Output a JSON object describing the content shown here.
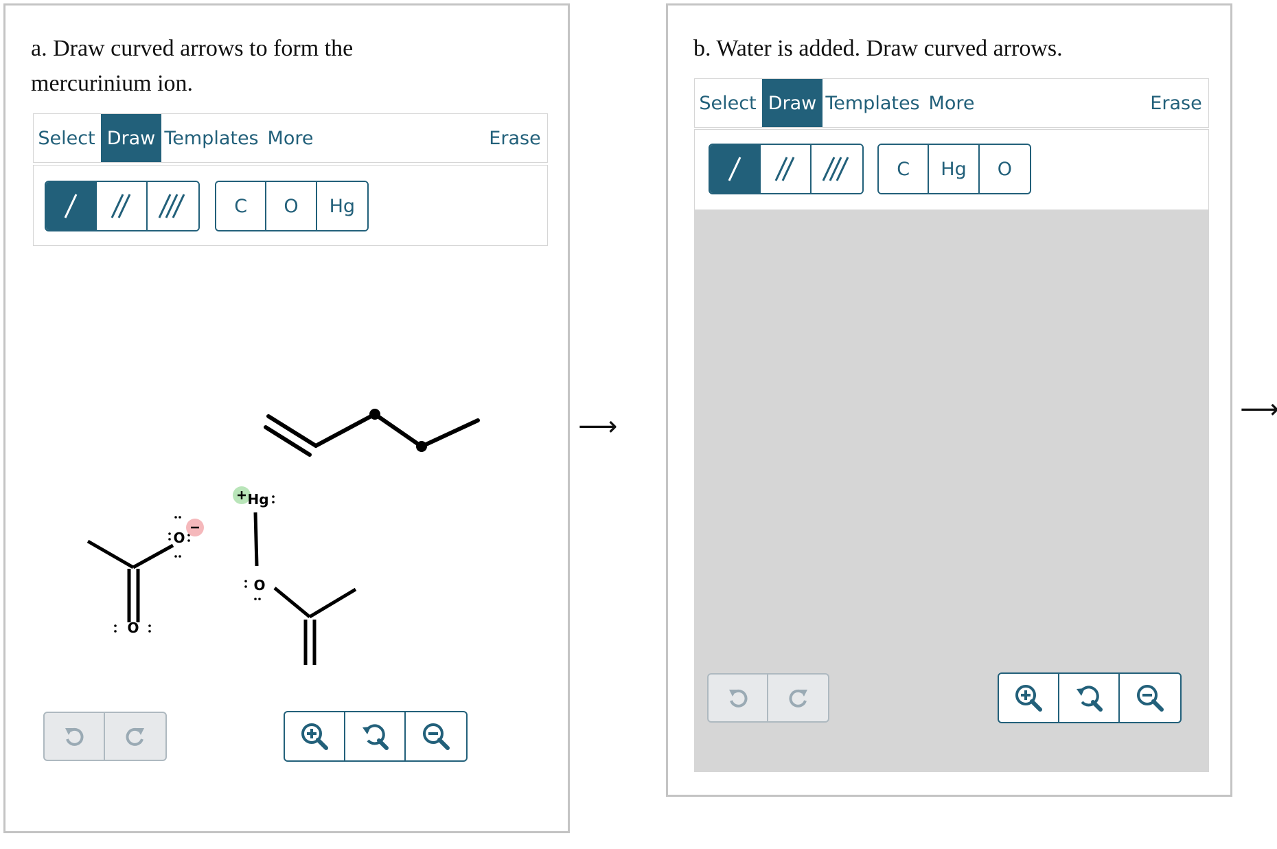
{
  "panel_a": {
    "question": "a. Draw curved arrows to form the mercurinium ion.",
    "tabs": {
      "select": "Select",
      "draw": "Draw",
      "templates": "Templates",
      "more": "More",
      "erase": "Erase"
    },
    "atom_buttons": [
      "C",
      "O",
      "Hg"
    ],
    "molecule_labels": {
      "o_anion": "O",
      "hg": "Hg",
      "o_ester": "O",
      "o_carbonyl_left": "O",
      "o_carbonyl_right": "O"
    }
  },
  "panel_b": {
    "question": "b. Water is added. Draw curved arrows.",
    "tabs": {
      "select": "Select",
      "draw": "Draw",
      "templates": "Templates",
      "more": "More",
      "erase": "Erase"
    },
    "atom_buttons": [
      "C",
      "Hg",
      "O"
    ]
  },
  "separators": {
    "arrow": "⟶"
  },
  "colors": {
    "accent": "#22607a",
    "canvas_bg": "#d6d6d6",
    "positive_charge": "#b9e5b9",
    "negative_charge": "#f5b8bb"
  },
  "icons": {
    "single_bond": "single-bond-icon",
    "double_bond": "double-bond-icon",
    "triple_bond": "triple-bond-icon",
    "undo": "undo-icon",
    "redo": "redo-icon",
    "zoom_in": "zoom-in-icon",
    "zoom_reset": "zoom-reset-icon",
    "zoom_out": "zoom-out-icon"
  }
}
